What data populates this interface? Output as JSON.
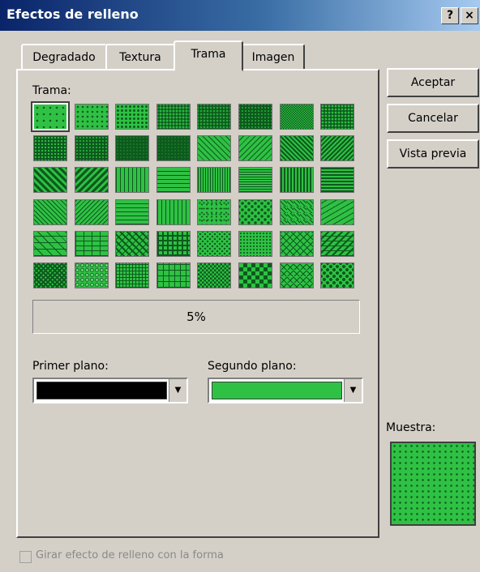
{
  "window": {
    "title": "Efectos de relleno",
    "help_label": "?",
    "close_label": "×"
  },
  "tabs": [
    {
      "label": "Degradado"
    },
    {
      "label": "Textura"
    },
    {
      "label": "Trama",
      "active": true
    },
    {
      "label": "Imagen"
    }
  ],
  "trama": {
    "label": "Trama:",
    "selected_pattern": "5%",
    "percent_label": "5%",
    "colors": {
      "foreground": "#000000",
      "background": "#2fc144"
    }
  },
  "foreground": {
    "label": "Primer plano:",
    "value_color": "#000000"
  },
  "background": {
    "label": "Segundo plano:",
    "value_color": "#2fc144"
  },
  "buttons": {
    "accept": "Aceptar",
    "cancel": "Cancelar",
    "preview": "Vista previa"
  },
  "sample": {
    "label": "Muestra:"
  },
  "rotate_option": {
    "label": "Girar efecto de relleno con la forma",
    "checked": false,
    "enabled": false
  },
  "patterns": [
    "5%",
    "10%",
    "20%",
    "25%",
    "30%",
    "40%",
    "50%",
    "60%",
    "70%",
    "75%",
    "80%",
    "90%",
    "light-downward-diagonal",
    "light-upward-diagonal",
    "dark-downward-diagonal",
    "dark-upward-diagonal",
    "wide-downward-diagonal",
    "wide-upward-diagonal",
    "light-vertical",
    "light-horizontal",
    "narrow-vertical",
    "narrow-horizontal",
    "dark-vertical",
    "dark-horizontal",
    "dashed-downward-diagonal",
    "dashed-upward-diagonal",
    "dashed-horizontal",
    "dashed-vertical",
    "small-confetti",
    "large-confetti",
    "zig-zag",
    "wave",
    "diagonal-brick",
    "horizontal-brick",
    "weave",
    "plaid",
    "divot",
    "dotted-grid",
    "dotted-diamond",
    "shingle",
    "trellis",
    "sphere",
    "small-grid",
    "large-grid",
    "small-checkerboard",
    "large-checkerboard",
    "outlined-diamond",
    "solid-diamond"
  ]
}
